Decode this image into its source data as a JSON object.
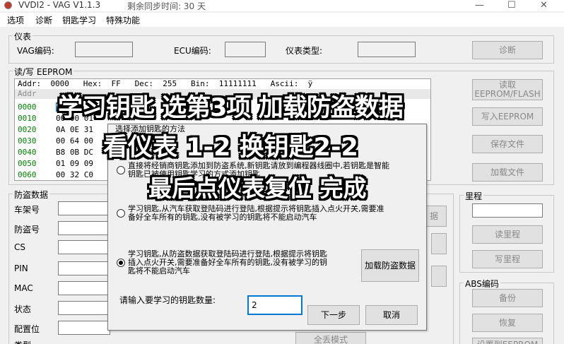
{
  "titlebar": {
    "title": "VVDI2 - VAG V1.1.3",
    "sync": "剩余同步时间: 30 天",
    "min": "—",
    "max": "☐",
    "close": "✕"
  },
  "menu": [
    "选项",
    "诊断",
    "钥匙学习",
    "特殊功能"
  ],
  "instrument": {
    "group": "仪表",
    "vag_label": "VAG编码:",
    "ecu_label": "ECU编码:",
    "type_label": "仪表类型:",
    "diag_button": "诊断"
  },
  "eeprom": {
    "group": "读/写 EEPROM",
    "header": "Addr:  0000   Hex:  FF   Dec:  255   Bin:  11111111   Ascii:  ÿ",
    "col_addr": "Addr",
    "addresses": [
      "0000",
      "0010",
      "0020",
      "0030",
      "0040",
      "0050",
      "0060"
    ],
    "rows": [
      "FF",
      "00 00 01",
      "0A 0E 31",
      "00 64 00",
      "B8 0B DC",
      "01 09 09",
      "00 32 C0"
    ],
    "read_button": "读取\nEEPROM/FLASH",
    "write_button": "写入EEPROM",
    "save_button": "保存文件",
    "load_button": "加载文件"
  },
  "immo": {
    "group": "防盗数据",
    "labels": [
      "车架号",
      "防盗号",
      "CS",
      "PIN",
      "MAC",
      "状态",
      "配置位",
      "类型"
    ],
    "side_button": "据",
    "all_keys": "全丢模式"
  },
  "mileage": {
    "group": "里程",
    "read": "读里程",
    "write": "写里程"
  },
  "abs": {
    "group": "ABS编码",
    "backup": "备份",
    "restore": "恢复",
    "set": "设置到EEPROM"
  },
  "dialog": {
    "title": "选择添加钥匙的方法",
    "option1": "直接将经销商钥匙添加到防盗系统,新钥匙请放到编程器线圈中,若钥匙是智能\n钥匙已被使用钥匙学习的方式添加钥匙",
    "option2": "学习钥匙,从汽车获取登陆码进行登陆,根据提示将钥匙插入点火开关,需要准\n备好全车所有的钥匙,没有被学习的钥匙将不能启动汽车",
    "option3": "学习钥匙,从防盗数据获取登陆码进行登陆,根据提示将钥匙\n插入点火开关,需要准备好全车所有的钥匙,没有被学习的钥\n匙将不能启动汽车",
    "load_immo_button": "加载防盗数据",
    "count_label": "请输入要学习的钥匙数量:",
    "count_value": "2",
    "next_button": "下一步",
    "cancel_button": "取消",
    "selected_option": 3
  },
  "overlay": {
    "line1": "学习钥匙 选第3项 加载防盗数据",
    "line2": "看仪表 1-2  换钥匙2-2",
    "line3": "最后点仪表复位 完成"
  },
  "colors": {
    "overlay_text": "#ffffff",
    "overlay_stroke": "#000000",
    "addr_green": "#008000"
  }
}
